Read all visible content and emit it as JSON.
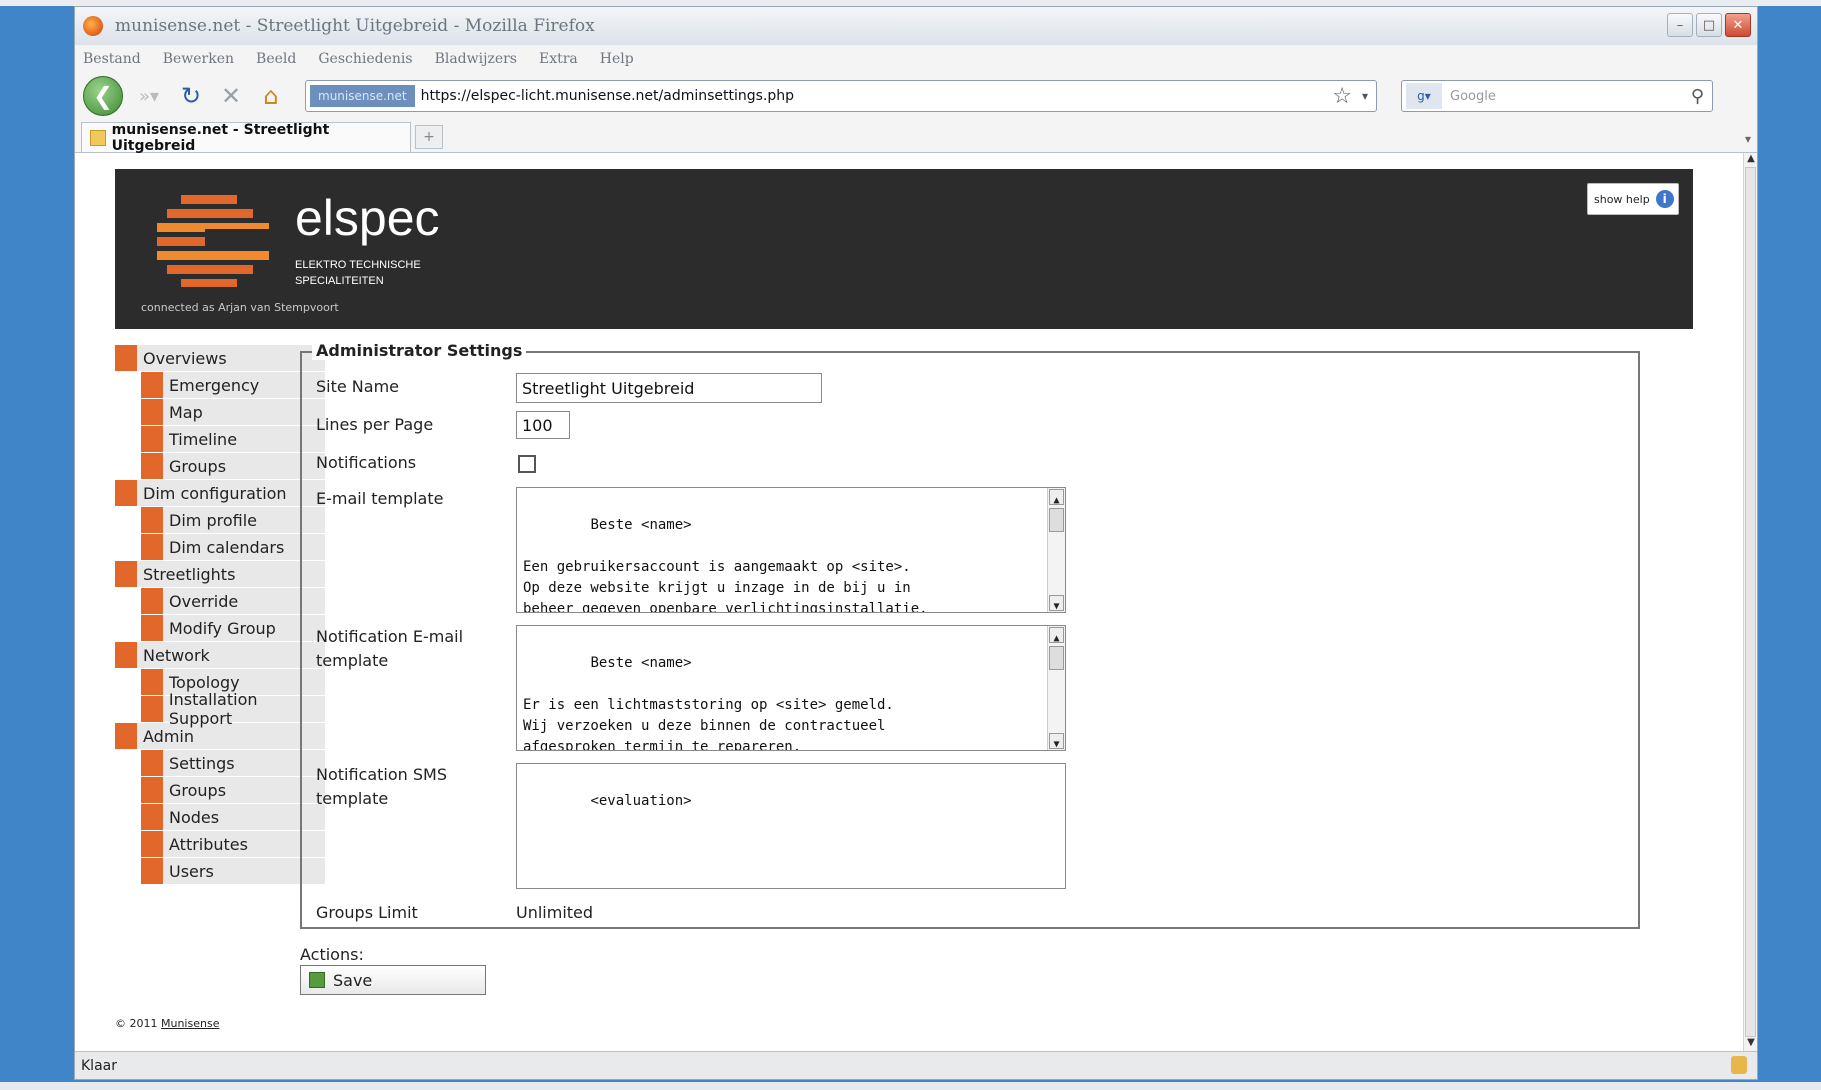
{
  "browser": {
    "title": "munisense.net - Streetlight Uitgebreid - Mozilla Firefox",
    "menu": [
      "Bestand",
      "Bewerken",
      "Beeld",
      "Geschiedenis",
      "Bladwijzers",
      "Extra",
      "Help"
    ],
    "site_identity": "munisense.net",
    "url": "https://elspec-licht.munisense.net/adminsettings.php",
    "search_placeholder": "Google",
    "tab_title": "munisense.net - Streetlight Uitgebreid",
    "new_tab": "+",
    "status": "Klaar"
  },
  "header": {
    "logo_name": "elspec",
    "logo_sub": "ELEKTRO TECHNISCHE SPECIALITEITEN",
    "connected_as": "connected as Arjan van Stempvoort",
    "help_label": "show help",
    "help_icon": "info-icon",
    "logo_colors": [
      "#e2672a",
      "#f08a2e"
    ]
  },
  "sidebar": {
    "sections": [
      {
        "label": "Overviews",
        "items": [
          "Emergency",
          "Map",
          "Timeline",
          "Groups"
        ]
      },
      {
        "label": "Dim configuration",
        "items": [
          "Dim profile",
          "Dim calendars"
        ]
      },
      {
        "label": "Streetlights",
        "items": [
          "Override",
          "Modify Group"
        ]
      },
      {
        "label": "Network",
        "items": [
          "Topology",
          "Installation Support"
        ]
      },
      {
        "label": "Admin",
        "items": [
          "Settings",
          "Groups",
          "Nodes",
          "Attributes",
          "Users"
        ]
      }
    ]
  },
  "form": {
    "legend": "Administrator Settings",
    "site_name_label": "Site Name",
    "site_name_value": "Streetlight Uitgebreid",
    "lines_label": "Lines per Page",
    "lines_value": "100",
    "notifications_label": "Notifications",
    "notifications_checked": false,
    "email_template_label": "E-mail template",
    "email_template_value": "Beste <name>\n\nEen gebruikersaccount is aangemaakt op <site>.\nOp deze website krijgt u inzage in de bij u in\nbeheer gegeven openbare verlichtingsinstallatie.",
    "notif_email_label_1": "Notification E-mail",
    "notif_email_label_2": "template",
    "notif_email_value": "Beste <name>\n\nEr is een lichtmaststoring op <site> gemeld.\nWij verzoeken u deze binnen de contractueel\nafgesproken termijn te repareren.",
    "notif_sms_label_1": "Notification SMS",
    "notif_sms_label_2": "template",
    "notif_sms_value": "<evaluation>",
    "groups_limit_label": "Groups Limit",
    "groups_limit_value": "Unlimited"
  },
  "actions": {
    "label": "Actions:",
    "save_label": "Save"
  },
  "footer": {
    "copyright": "© 2011",
    "company": "Munisense"
  },
  "colors": {
    "accent": "#e2672a",
    "header_bg": "#2c2c2c",
    "desktop": "#3f85c8"
  }
}
